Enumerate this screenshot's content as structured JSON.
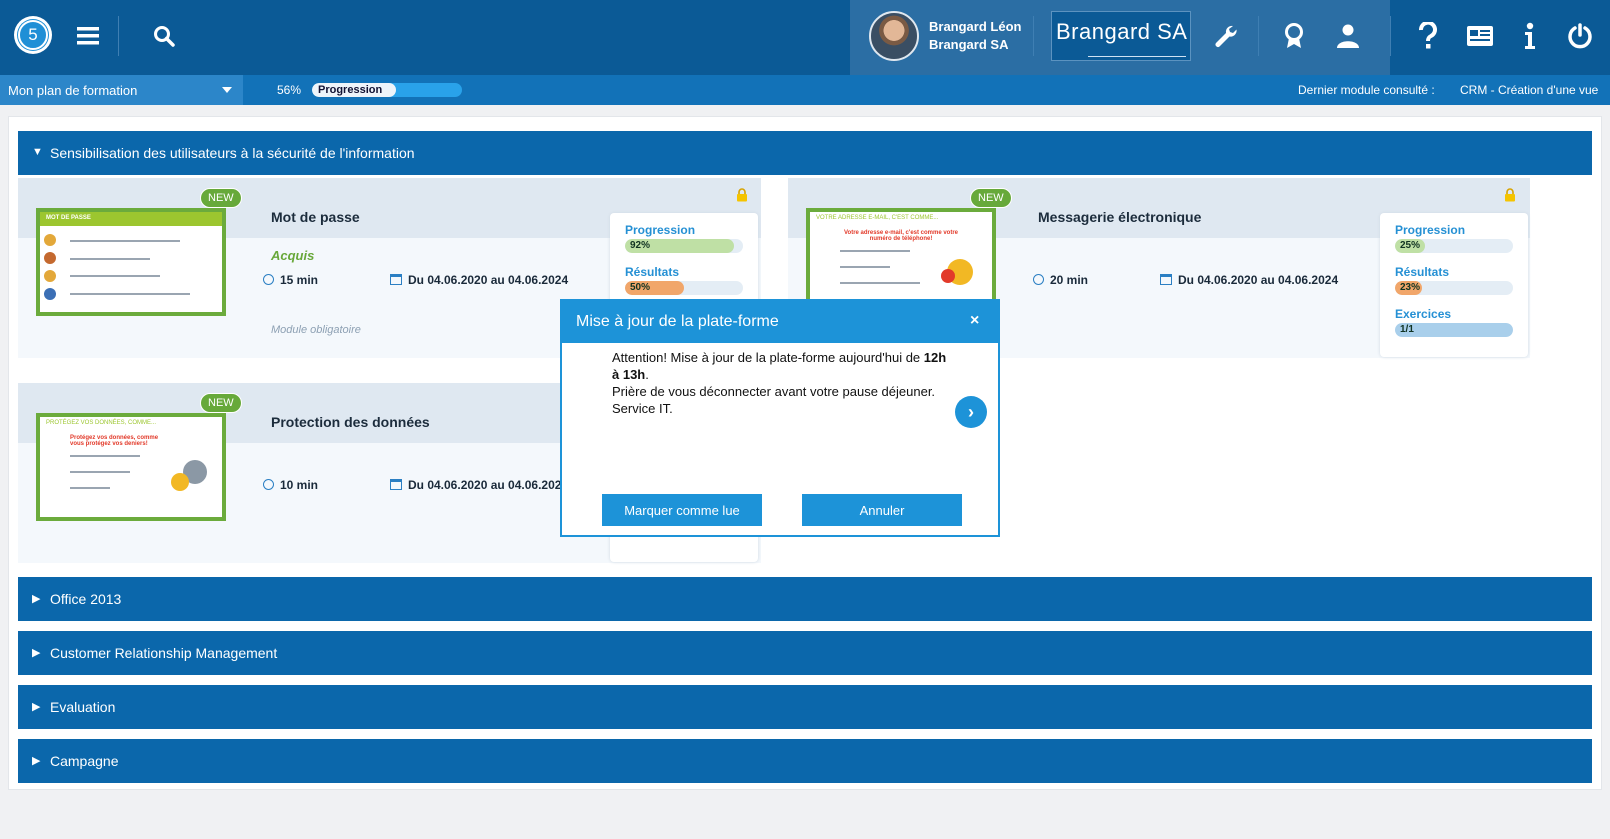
{
  "header": {
    "logo_number": "5",
    "user_name": "Brangard Léon",
    "user_company": "Brangard SA",
    "brand_name": "Brangard SA"
  },
  "subbar": {
    "plan_label": "Mon plan de formation",
    "progress_pct_text": "56%",
    "progress_value": 56,
    "progress_label": "Progression",
    "last_module_label": "Dernier module consulté :",
    "last_module_value": "CRM - Création d'une vue"
  },
  "sections": [
    {
      "title": "Sensibilisation des utilisateurs à la sécurité de l'information",
      "expanded": true
    },
    {
      "title": "Office 2013",
      "expanded": false
    },
    {
      "title": "Customer Relationship Management",
      "expanded": false
    },
    {
      "title": "Evaluation",
      "expanded": false
    },
    {
      "title": "Campagne",
      "expanded": false
    }
  ],
  "cards": [
    {
      "badge": "NEW",
      "title": "Mot de passe",
      "status": "Acquis",
      "duration": "15 min",
      "dates": "Du 04.06.2020 au 04.06.2024",
      "note": "Module obligatoire",
      "thumb_title": "MOT DE PASSE",
      "stats": [
        {
          "label": "Progression",
          "value": "92%",
          "level": 92,
          "color": "#bfe0a5"
        },
        {
          "label": "Résultats",
          "value": "50%",
          "level": 50,
          "color": "#f1a66a"
        }
      ]
    },
    {
      "badge": "NEW",
      "title": "Messagerie électronique",
      "duration": "20 min",
      "dates": "Du 04.06.2020 au 04.06.2024",
      "thumb_title": "VOTRE ADRESSE E-MAIL, C'EST COMME...",
      "thumb_text": "Votre adresse e-mail, c'est comme votre numéro de téléphone!",
      "stats": [
        {
          "label": "Progression",
          "value": "25%",
          "level": 25,
          "color": "#bfe0a5"
        },
        {
          "label": "Résultats",
          "value": "23%",
          "level": 23,
          "color": "#f1a66a"
        },
        {
          "label": "Exercices",
          "value": "1/1",
          "level": 100,
          "color": "#a9cfeb"
        }
      ]
    },
    {
      "badge": "NEW",
      "title": "Protection des données",
      "duration": "10 min",
      "dates": "Du 04.06.2020 au 04.06.2024",
      "thumb_title": "PROTÉGEZ VOS DONNÉES, COMME...",
      "thumb_text": "Protégez vos données, comme vous protégez vos deniers!"
    }
  ],
  "modal": {
    "title": "Mise à jour de la plate-forme",
    "close": "×",
    "line1_pre": "Attention! Mise à jour de la plate-forme aujourd'hui de ",
    "line1_bold": "12h",
    "line2_bold": "à 13h",
    "line2_post": ".",
    "line3": "Prière de vous déconnecter avant votre pause déjeuner.",
    "line4": "Service IT.",
    "mark_read": "Marquer comme lue",
    "cancel": "Annuler",
    "next_glyph": "›"
  },
  "icons": [
    "menu-icon",
    "search-icon",
    "wrench-icon",
    "award-icon",
    "user-icon",
    "help-icon",
    "news-icon",
    "info-icon",
    "power-icon"
  ],
  "colors": {
    "primary": "#0b5a96",
    "section": "#0b67ab",
    "accent": "#1d93d8",
    "green": "#67a93a"
  }
}
